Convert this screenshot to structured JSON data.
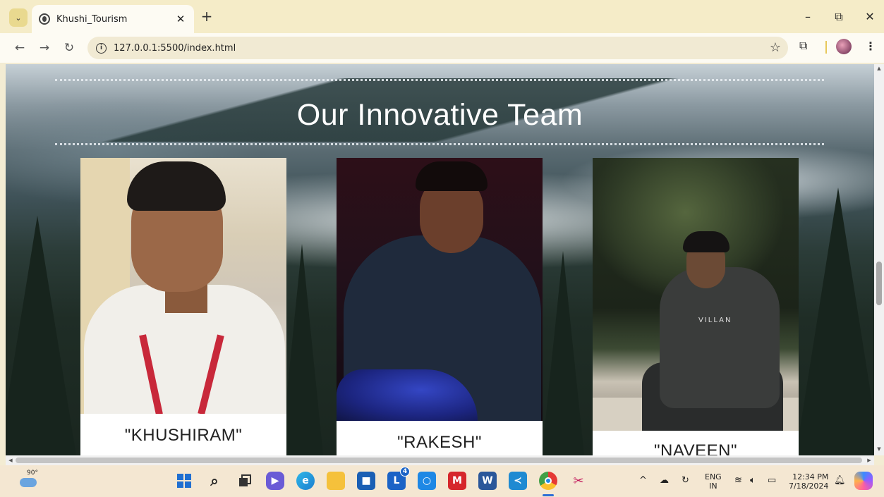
{
  "browser": {
    "tab_title": "Khushi_Tourism",
    "tab_close": "✕",
    "new_tab": "+",
    "url": "127.0.0.1:5500/index.html",
    "window_controls": {
      "minimize": "–",
      "restore": "⧉",
      "close": "✕"
    }
  },
  "page": {
    "section_title": "Our Innovative Team",
    "members": [
      {
        "name": "\"KHUSHIRAM\""
      },
      {
        "name": "\"RAKESH\""
      },
      {
        "name": "\"NAVEEN\""
      }
    ],
    "hoodie_print": "VILLAN"
  },
  "taskbar": {
    "weather_temp": "90°",
    "language_top": "ENG",
    "language_bottom": "IN",
    "time": "12:34 PM",
    "date": "7/18/2024",
    "outlook_badge": "4"
  },
  "icons": [
    "chevron-down-icon",
    "globe-icon",
    "back-arrow-icon",
    "forward-arrow-icon",
    "reload-icon",
    "info-icon",
    "star-icon",
    "extensions-icon",
    "profile-icon",
    "menu-icon",
    "weather-icon",
    "windows-start-icon",
    "search-icon",
    "task-view-icon",
    "teams-icon",
    "edge-icon",
    "file-explorer-icon",
    "store-icon",
    "outlook-icon",
    "security-icon",
    "mcafee-icon",
    "word-icon",
    "vscode-icon",
    "chrome-icon",
    "snipping-tool-icon",
    "chevron-up-icon",
    "onedrive-icon",
    "sync-icon",
    "wifi-icon",
    "volume-icon",
    "battery-icon",
    "notification-bell-icon",
    "copilot-icon"
  ]
}
